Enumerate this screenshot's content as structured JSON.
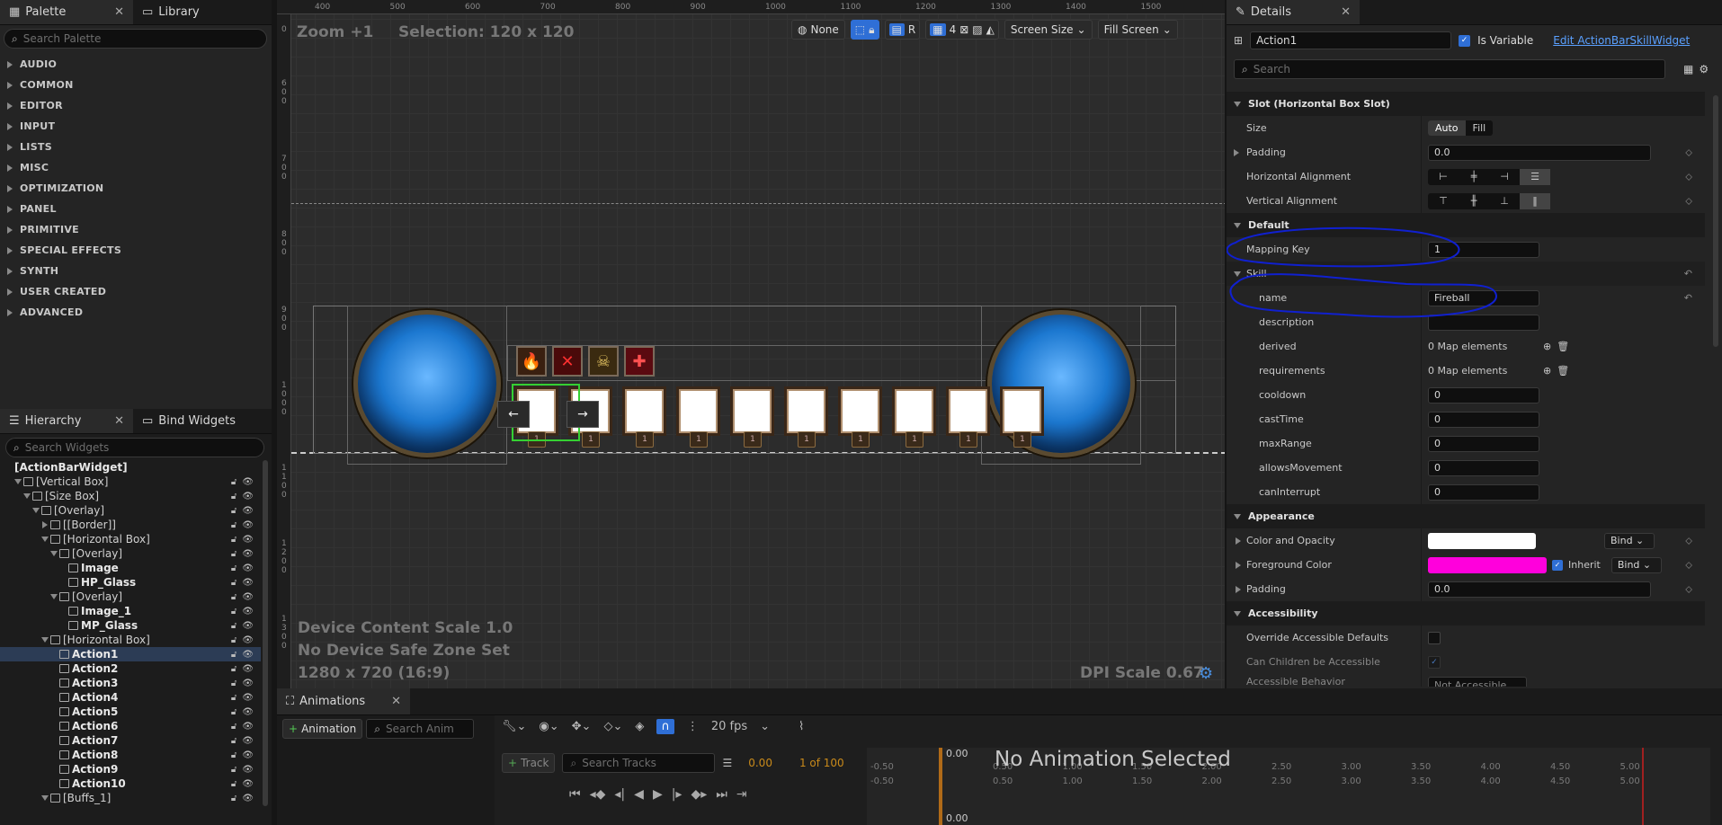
{
  "palette": {
    "tab_label": "Palette",
    "library_tab": "Library",
    "search_placeholder": "Search Palette",
    "categories": [
      "AUDIO",
      "COMMON",
      "EDITOR",
      "INPUT",
      "LISTS",
      "MISC",
      "OPTIMIZATION",
      "PANEL",
      "PRIMITIVE",
      "SPECIAL EFFECTS",
      "SYNTH",
      "USER CREATED",
      "ADVANCED"
    ]
  },
  "hierarchy": {
    "tab_label": "Hierarchy",
    "bind_tab": "Bind Widgets",
    "search_placeholder": "Search Widgets",
    "items": [
      {
        "label": "[ActionBarWidget]"
      },
      {
        "label": "[Vertical Box]"
      },
      {
        "label": "[Size Box]"
      },
      {
        "label": "[Overlay]"
      },
      {
        "label": "[[Border]]"
      },
      {
        "label": "[Horizontal Box]"
      },
      {
        "label": "[Overlay]"
      },
      {
        "label": "Image"
      },
      {
        "label": "HP_Glass"
      },
      {
        "label": "[Overlay]"
      },
      {
        "label": "Image_1"
      },
      {
        "label": "MP_Glass"
      },
      {
        "label": "[Horizontal Box]"
      },
      {
        "label": "Action1"
      },
      {
        "label": "Action2"
      },
      {
        "label": "Action3"
      },
      {
        "label": "Action4"
      },
      {
        "label": "Action5"
      },
      {
        "label": "Action6"
      },
      {
        "label": "Action7"
      },
      {
        "label": "Action8"
      },
      {
        "label": "Action9"
      },
      {
        "label": "Action10"
      },
      {
        "label": "[Buffs_1]"
      }
    ]
  },
  "viewport": {
    "zoom": "Zoom +1",
    "selection": "Selection: 120 x 120",
    "none_label": "None",
    "r_label": "R",
    "grid_value": "4",
    "screen_size": "Screen Size",
    "fill_screen": "Fill Screen",
    "ruler_top": [
      "400",
      "500",
      "600",
      "700",
      "800",
      "900",
      "1000",
      "1100",
      "1200",
      "1300",
      "1400",
      "1500"
    ],
    "ruler_left": [
      [
        "6",
        "0",
        "0"
      ],
      [
        "7",
        "0",
        "0"
      ],
      [
        "8",
        "0",
        "0"
      ],
      [
        "9",
        "0",
        "0"
      ],
      [
        "1",
        "0",
        "0",
        "0"
      ],
      [
        "1",
        "1",
        "0",
        "0"
      ],
      [
        "1",
        "2",
        "0",
        "0"
      ],
      [
        "1",
        "3",
        "0",
        "0"
      ]
    ],
    "ruler_left_zero": "0",
    "device_scale": "Device Content Scale 1.0",
    "safe_zone": "No Device Safe Zone Set",
    "resolution": "1280 x 720 (16:9)",
    "dpi": "DPI Scale 0.67",
    "slot_keys": [
      "1",
      "1",
      "1",
      "1",
      "1",
      "1",
      "1",
      "1",
      "1",
      "1"
    ],
    "arrow_left": "←",
    "arrow_right": "→",
    "buff_icons": [
      "🔥",
      "✕",
      "☠",
      "✚"
    ]
  },
  "details": {
    "tab_label": "Details",
    "widget_name": "Action1",
    "is_variable": "Is Variable",
    "edit_link": "Edit ActionBarSkillWidget",
    "search_placeholder": "Search",
    "slot_section": "Slot (Horizontal Box Slot)",
    "size_label": "Size",
    "size_auto": "Auto",
    "size_fill": "Fill",
    "padding_label": "Padding",
    "padding_value": "0.0",
    "halign_label": "Horizontal Alignment",
    "valign_label": "Vertical Alignment",
    "default_section": "Default",
    "mapping_key_label": "Mapping Key",
    "mapping_key_value": "1",
    "skill_section": "Skill",
    "name_label": "name",
    "name_value": "Fireball",
    "description_label": "description",
    "derived_label": "derived",
    "derived_value": "0 Map elements",
    "requirements_label": "requirements",
    "requirements_value": "0 Map elements",
    "cooldown_label": "cooldown",
    "cooldown_value": "0",
    "casttime_label": "castTime",
    "casttime_value": "0",
    "maxrange_label": "maxRange",
    "maxrange_value": "0",
    "allowsmovement_label": "allowsMovement",
    "allowsmovement_value": "0",
    "caninterrupt_label": "canInterrupt",
    "caninterrupt_value": "0",
    "appearance_section": "Appearance",
    "color_opacity_label": "Color and Opacity",
    "bind_label": "Bind",
    "foreground_label": "Foreground Color",
    "inherit_label": "Inherit",
    "padding2_label": "Padding",
    "padding2_value": "0.0",
    "accessibility_section": "Accessibility",
    "override_label": "Override Accessible Defaults",
    "children_label": "Can Children be Accessible",
    "behavior_label": "Accessible Behavior",
    "behavior_value": "Not Accessible",
    "foreground_color": "#ff00dc",
    "color_opacity_color": "#ffffff"
  },
  "animations": {
    "tab_label": "Animations",
    "add_button": "Animation",
    "search_placeholder": "Search Anim",
    "fps": "20 fps",
    "track_button": "Track",
    "search_tracks": "Search Tracks",
    "time_value": "0.00",
    "frame_of": "1 of 100",
    "no_anim": "No Animation Selected",
    "playhead_time": "0.00",
    "ruler": [
      "-0.50",
      "0.50",
      "1.00",
      "1.50",
      "2.00",
      "2.50",
      "3.00",
      "3.50",
      "4.00",
      "4.50",
      "5.00"
    ]
  },
  "colors": {
    "selection_green": "#35d032",
    "annotation_blue": "#1020d0",
    "accent": "#2f6fd6"
  }
}
